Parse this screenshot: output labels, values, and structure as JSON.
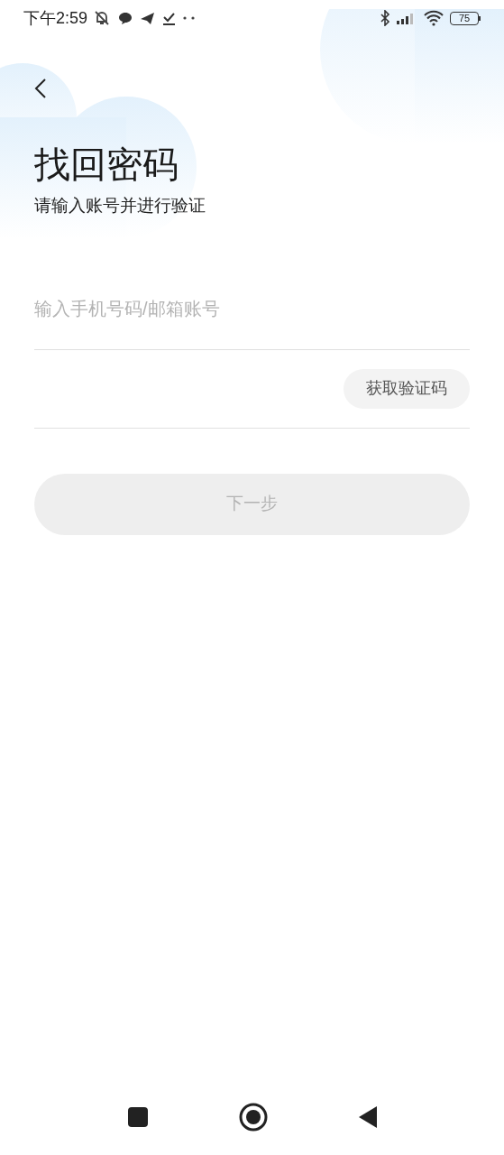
{
  "status_bar": {
    "time": "下午2:59",
    "battery": "75"
  },
  "title": "找回密码",
  "subtitle": "请输入账号并进行验证",
  "account_field": {
    "placeholder": "输入手机号码/邮箱账号"
  },
  "code_field": {
    "button": "获取验证码"
  },
  "next_button": {
    "label": "下一步",
    "disabled": true
  }
}
